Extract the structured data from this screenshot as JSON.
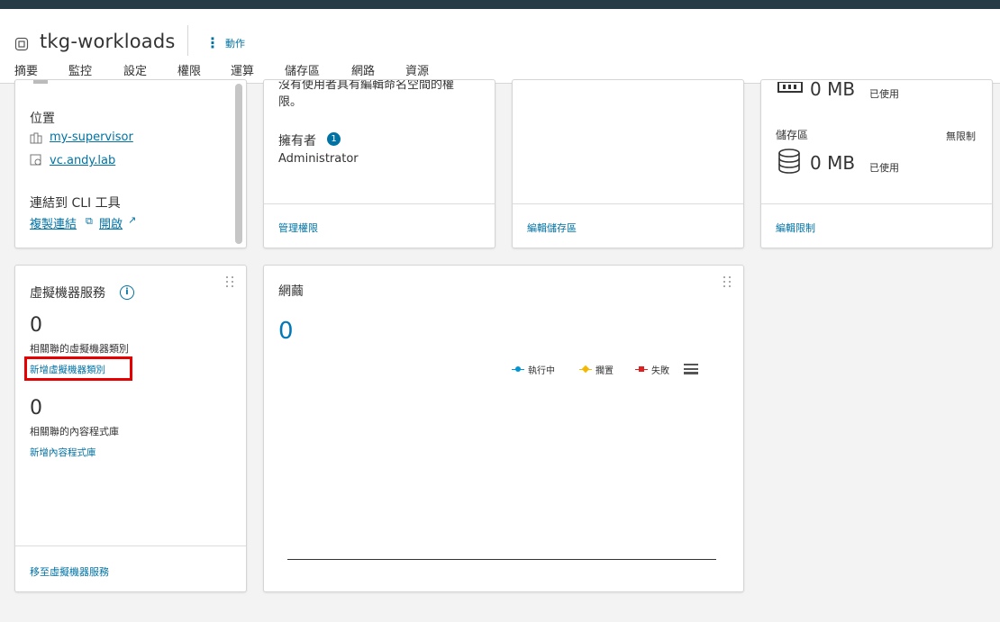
{
  "header": {
    "title": "tkg-workloads",
    "actions_label": "動作",
    "tabs": [
      {
        "label": "摘要",
        "active": true
      },
      {
        "label": "監控"
      },
      {
        "label": "設定"
      },
      {
        "label": "權限"
      },
      {
        "label": "運算"
      },
      {
        "label": "儲存區"
      },
      {
        "label": "網路"
      },
      {
        "label": "資源"
      }
    ]
  },
  "status_card": {
    "location_label": "位置",
    "supervisor_link": "my-supervisor",
    "vcenter_link": "vc.andy.lab",
    "cli_label": "連結到 CLI 工具",
    "copy_link": "複製連結",
    "open_link": "開啟"
  },
  "permissions_card": {
    "desc_line1": "沒有使用者具有編輯命名空間的權",
    "desc_line2": "限。",
    "owner_label": "擁有者",
    "owner_badge": "1",
    "owner_value": "Administrator",
    "footer": "管理權限"
  },
  "storage_card": {
    "footer": "編輯儲存區"
  },
  "capacity_card": {
    "memory_value": "0 MB",
    "memory_unit_label": "已使用",
    "storage_label": "儲存區",
    "storage_limit": "無限制",
    "storage_value": "0 MB",
    "storage_unit_label": "已使用",
    "footer": "編輯限制"
  },
  "vm_service_card": {
    "title": "虛擬機器服務",
    "vm_class_count": "0",
    "vm_class_label": "相關聯的虛擬機器類別",
    "add_vm_class_link": "新增虛擬機器類別",
    "content_lib_count": "0",
    "content_lib_label": "相關聯的內容程式庫",
    "add_content_lib_link": "新增內容程式庫",
    "footer": "移至虛擬機器服務"
  },
  "pods_card": {
    "title": "網繭",
    "count": "0",
    "legend": [
      {
        "label": "執行中",
        "color": "#0095d3"
      },
      {
        "label": "擱置",
        "color": "#f5b800"
      },
      {
        "label": "失敗",
        "color": "#e02020"
      }
    ]
  }
}
